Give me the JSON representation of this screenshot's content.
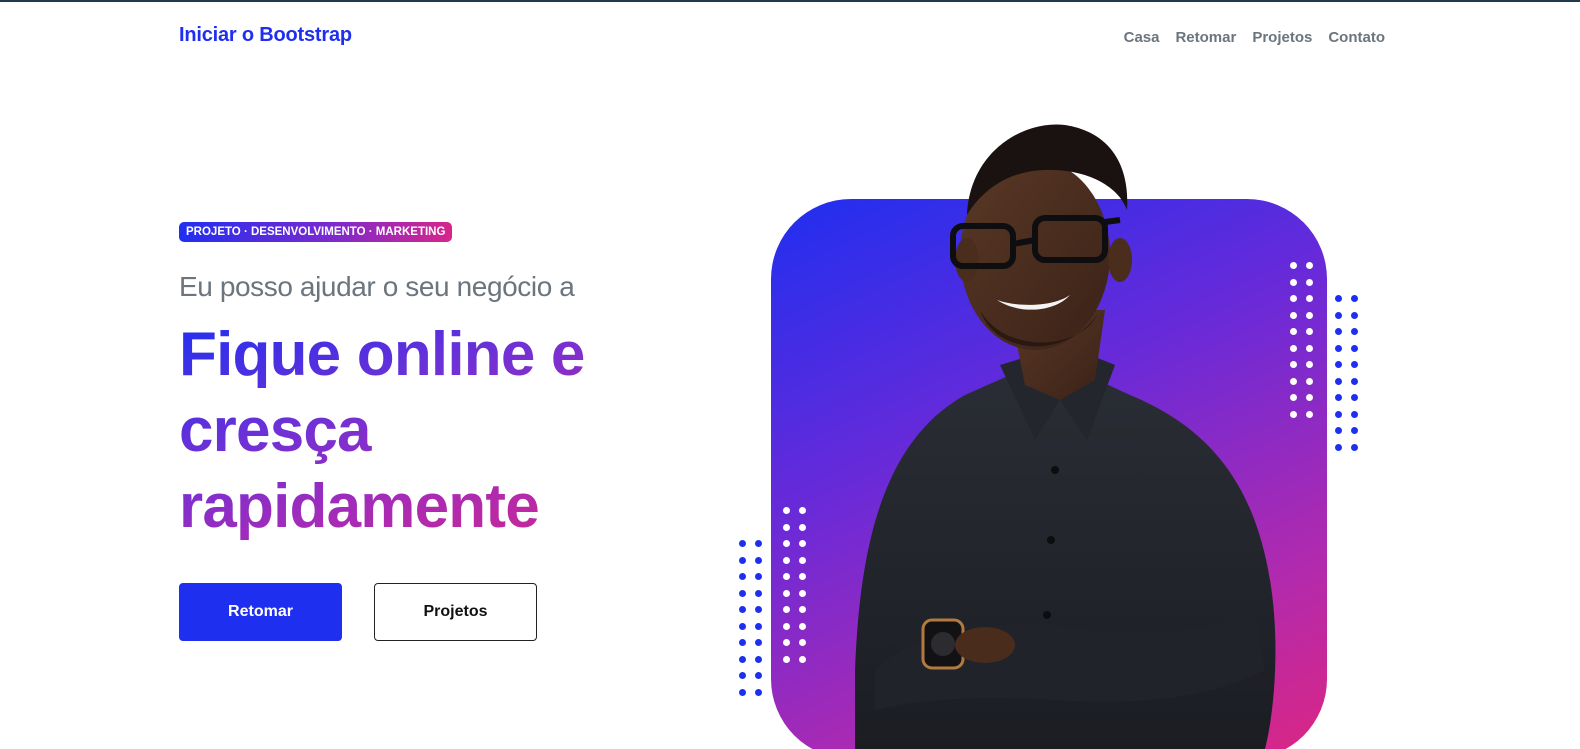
{
  "navbar": {
    "brand": "Iniciar o Bootstrap",
    "links": [
      "Casa",
      "Retomar",
      "Projetos",
      "Contato"
    ]
  },
  "hero": {
    "badge": "PROJETO · DESENVOLVIMENTO · MARKETING",
    "subhead": "Eu posso ajudar o seu negócio a",
    "headline_lines": [
      "Fique online e",
      "cresça",
      "rapidamente"
    ],
    "primary_button": "Retomar",
    "secondary_button": "Projetos"
  },
  "colors": {
    "brand_blue": "#1f2ff0",
    "gradient_purple": "#7a2ad0",
    "gradient_pink": "#d7268a",
    "muted_text": "#6c757d"
  },
  "image": {
    "subject": "portrait-of-smiling-man"
  }
}
